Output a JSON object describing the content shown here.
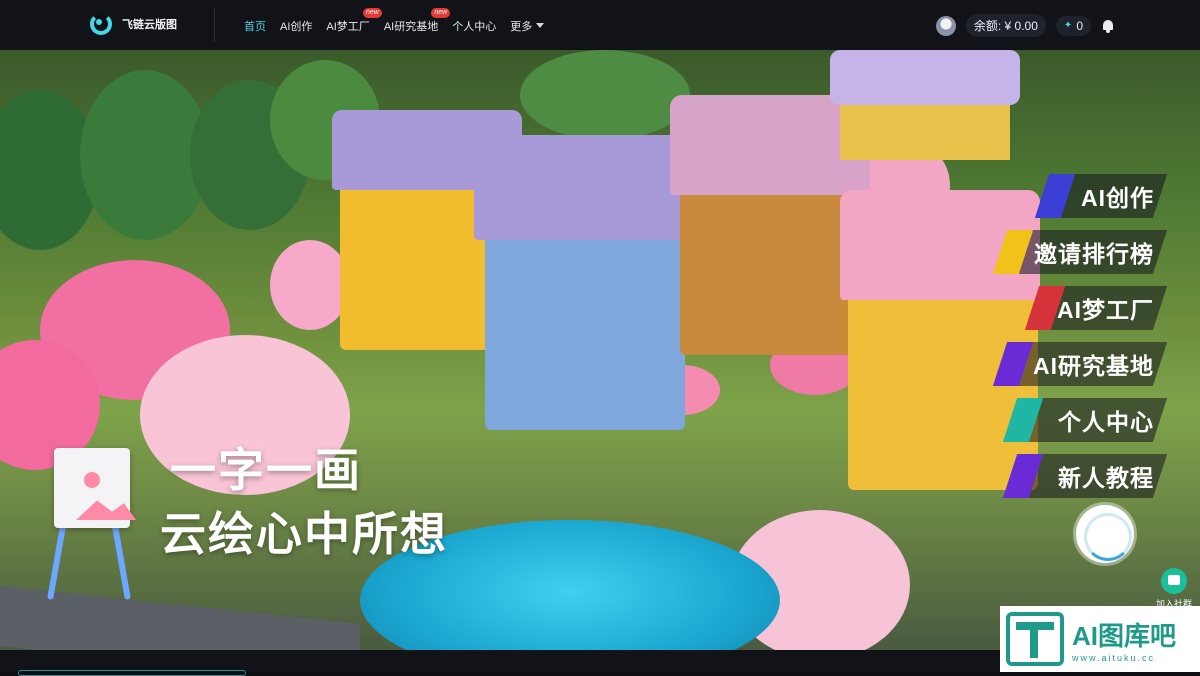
{
  "brand": {
    "name": "飞链云版图"
  },
  "nav": {
    "items": [
      {
        "label": "首页",
        "active": true,
        "badge": ""
      },
      {
        "label": "AI创作",
        "active": false,
        "badge": ""
      },
      {
        "label": "AI梦工厂",
        "active": false,
        "badge": "new"
      },
      {
        "label": "AI研究基地",
        "active": false,
        "badge": "new"
      },
      {
        "label": "个人中心",
        "active": false,
        "badge": ""
      },
      {
        "label": "更多",
        "active": false,
        "badge": ""
      }
    ]
  },
  "account": {
    "balance": "余额: ¥ 0.00",
    "points": "0"
  },
  "hero": {
    "line1": "一字一画",
    "line2": "云绘心中所想"
  },
  "side_menu": [
    {
      "label": "AI创作",
      "color": "#3b3fd6"
    },
    {
      "label": "邀请排行榜",
      "color": "#f2c21b"
    },
    {
      "label": "AI梦工厂",
      "color": "#d6323a"
    },
    {
      "label": "AI研究基地",
      "color": "#6a2bd6"
    },
    {
      "label": "个人中心",
      "color": "#1fb6a4"
    },
    {
      "label": "新人教程",
      "color": "#6a2bd6"
    }
  ],
  "floating": {
    "join_label": "加入社群"
  },
  "watermark": {
    "main": "AI图库吧",
    "sub": "www.aituku.cc"
  }
}
